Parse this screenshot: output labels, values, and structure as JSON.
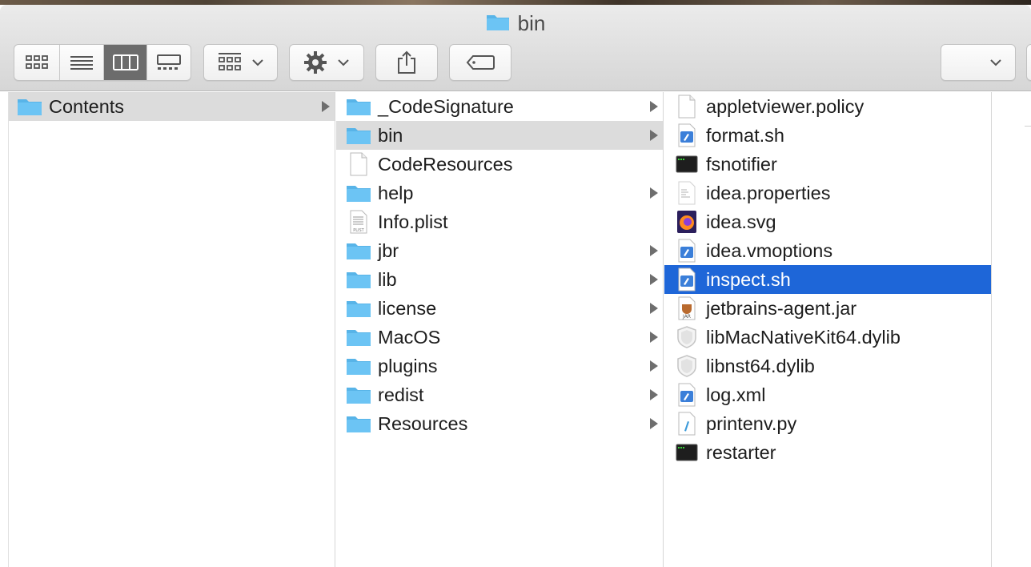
{
  "window": {
    "title": "bin"
  },
  "toolbar": {
    "view_modes": [
      {
        "name": "icon-view",
        "icon": "icon-grid-icon",
        "active": false
      },
      {
        "name": "list-view",
        "icon": "list-lines-icon",
        "active": false
      },
      {
        "name": "column-view",
        "icon": "columns-icon",
        "active": true
      },
      {
        "name": "gallery-view",
        "icon": "gallery-icon",
        "active": false
      }
    ],
    "group_icon": "group-grid-icon",
    "action_icon": "gear-icon",
    "share_icon": "share-icon",
    "tag_icon": "tag-icon",
    "path_dropdown_icon": "chevron-down-icon"
  },
  "columns": [
    {
      "items": [
        {
          "label": "Contents",
          "kind": "folder",
          "has_children": true,
          "selected": "gray"
        }
      ]
    },
    {
      "items": [
        {
          "label": "_CodeSignature",
          "kind": "folder",
          "has_children": true,
          "selected": ""
        },
        {
          "label": "bin",
          "kind": "folder",
          "has_children": true,
          "selected": "gray"
        },
        {
          "label": "CodeResources",
          "kind": "blank",
          "has_children": false,
          "selected": ""
        },
        {
          "label": "help",
          "kind": "folder",
          "has_children": true,
          "selected": ""
        },
        {
          "label": "Info.plist",
          "kind": "plist",
          "has_children": false,
          "selected": ""
        },
        {
          "label": "jbr",
          "kind": "folder",
          "has_children": true,
          "selected": ""
        },
        {
          "label": "lib",
          "kind": "folder",
          "has_children": true,
          "selected": ""
        },
        {
          "label": "license",
          "kind": "folder",
          "has_children": true,
          "selected": ""
        },
        {
          "label": "MacOS",
          "kind": "folder",
          "has_children": true,
          "selected": ""
        },
        {
          "label": "plugins",
          "kind": "folder",
          "has_children": true,
          "selected": ""
        },
        {
          "label": "redist",
          "kind": "folder",
          "has_children": true,
          "selected": ""
        },
        {
          "label": "Resources",
          "kind": "folder",
          "has_children": true,
          "selected": ""
        }
      ]
    },
    {
      "items": [
        {
          "label": "appletviewer.policy",
          "kind": "blank",
          "has_children": false,
          "selected": ""
        },
        {
          "label": "format.sh",
          "kind": "script",
          "has_children": false,
          "selected": ""
        },
        {
          "label": "fsnotifier",
          "kind": "exec",
          "has_children": false,
          "selected": ""
        },
        {
          "label": "idea.properties",
          "kind": "text",
          "has_children": false,
          "selected": ""
        },
        {
          "label": "idea.svg",
          "kind": "firefox",
          "has_children": false,
          "selected": ""
        },
        {
          "label": "idea.vmoptions",
          "kind": "script",
          "has_children": false,
          "selected": ""
        },
        {
          "label": "inspect.sh",
          "kind": "script",
          "has_children": false,
          "selected": "blue"
        },
        {
          "label": "jetbrains-agent.jar",
          "kind": "jar",
          "has_children": false,
          "selected": ""
        },
        {
          "label": "libMacNativeKit64.dylib",
          "kind": "dylib",
          "has_children": false,
          "selected": ""
        },
        {
          "label": "libnst64.dylib",
          "kind": "dylib",
          "has_children": false,
          "selected": ""
        },
        {
          "label": "log.xml",
          "kind": "script",
          "has_children": false,
          "selected": ""
        },
        {
          "label": "printenv.py",
          "kind": "python",
          "has_children": false,
          "selected": ""
        },
        {
          "label": "restarter",
          "kind": "exec",
          "has_children": false,
          "selected": ""
        }
      ]
    }
  ],
  "colors": {
    "folder": "#6cc4f4",
    "folder_tab": "#58b4e8",
    "selection_blue": "#1e66d8",
    "selection_gray": "#dcdcdc"
  }
}
